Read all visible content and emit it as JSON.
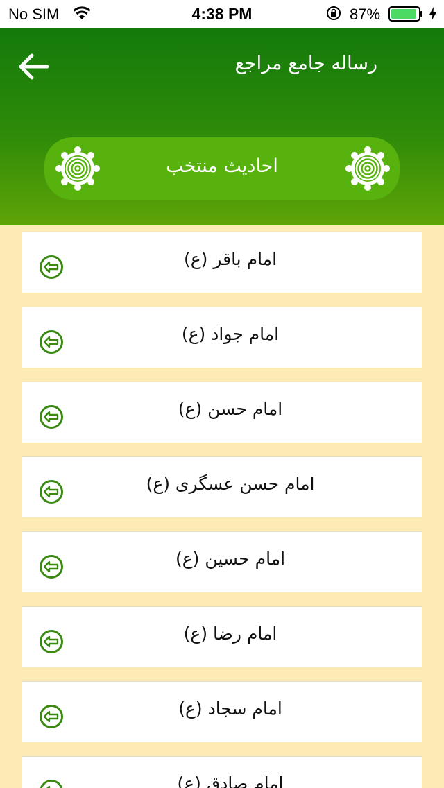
{
  "status_bar": {
    "carrier": "No SIM",
    "time": "4:38 PM",
    "battery": "87%"
  },
  "header": {
    "title": "رساله جامع مراجع",
    "back_icon": "arrow-left-icon"
  },
  "section": {
    "title": "احادیث منتخب",
    "ornament_icon": "ornament-medallion-icon"
  },
  "list": {
    "items": [
      {
        "label": "امام باقر (ع)"
      },
      {
        "label": "امام جواد (ع)"
      },
      {
        "label": "امام حسن (ع)"
      },
      {
        "label": "امام حسن عسگری (ع)"
      },
      {
        "label": "امام حسین (ع)"
      },
      {
        "label": "امام رضا (ع)"
      },
      {
        "label": "امام سجاد (ع)"
      },
      {
        "label": "امام صادق (ع)"
      }
    ],
    "item_icon": "circle-arrow-left-icon"
  },
  "colors": {
    "header_top": "#137A0A",
    "header_bottom": "#5FA407",
    "pill": "#58B20E",
    "background": "#FDEBB6",
    "icon_green": "#3A8A12",
    "battery_green": "#4CD964"
  }
}
